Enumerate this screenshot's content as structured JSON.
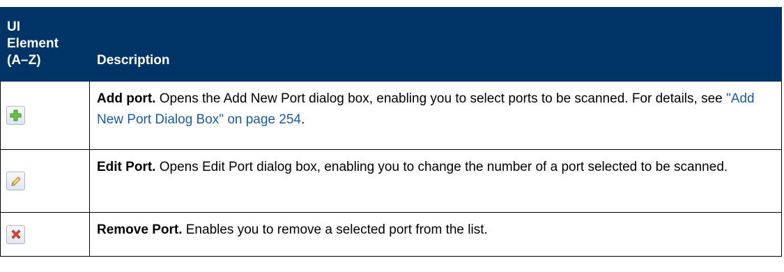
{
  "table": {
    "header": {
      "col_ui_line1": "UI",
      "col_ui_line2": "Element",
      "col_ui_line3": "(A–Z)",
      "col_desc": "Description"
    },
    "rows": [
      {
        "icon": "add-plus-icon",
        "term": "Add port.",
        "text": " Opens the Add New Port dialog box, enabling you to select ports to be scanned. For details, see ",
        "link": "\"Add New Port Dialog Box\" on page 254",
        "after": "."
      },
      {
        "icon": "edit-pencil-icon",
        "term": "Edit Port.",
        "text": " Opens Edit Port dialog box, enabling you to change the number of a port selected to be scanned."
      },
      {
        "icon": "remove-x-icon",
        "term": "Remove Port.",
        "text": " Enables you to remove a selected port from the list."
      }
    ]
  },
  "colors": {
    "header_bg": "#003366",
    "link": "#1a5aa0"
  }
}
